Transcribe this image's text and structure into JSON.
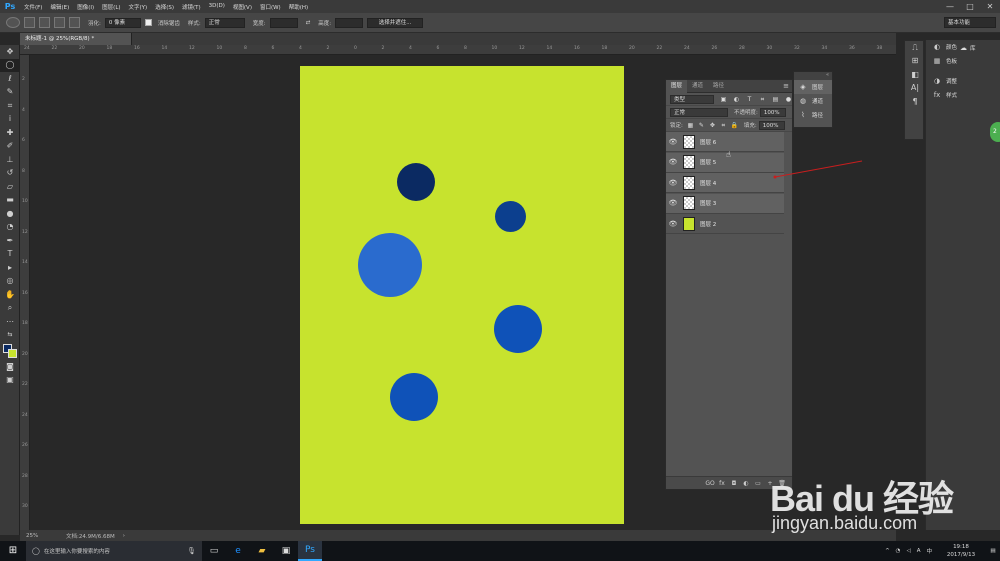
{
  "app": {
    "logo": "Ps"
  },
  "menu": [
    "文件(F)",
    "编辑(E)",
    "图像(I)",
    "图层(L)",
    "文字(Y)",
    "选择(S)",
    "滤镜(T)",
    "3D(D)",
    "视图(V)",
    "窗口(W)",
    "帮助(H)"
  ],
  "window_controls": [
    "—",
    "□",
    "✕"
  ],
  "options": {
    "feather_label": "羽化:",
    "feather_value": "0 像素",
    "antialias_label": "消除锯齿",
    "style_label": "样式:",
    "style_value": "正常",
    "width_label": "宽度:",
    "height_label": "高度:",
    "select_mask": "选择并遮住...",
    "workspace": "基本功能"
  },
  "document": {
    "tab_title": "未标题-1 @ 25%(RGB/8) *",
    "background_color": "#c7e32e",
    "circles": [
      {
        "color": "#0b2a62",
        "d": 38
      },
      {
        "color": "#0c3f8e",
        "d": 31
      },
      {
        "color": "#2a6bce",
        "d": 64
      },
      {
        "color": "#0f52b8",
        "d": 48
      },
      {
        "color": "#0f52b8",
        "d": 48
      }
    ]
  },
  "ruler_top": [
    "24",
    "22",
    "20",
    "18",
    "16",
    "14",
    "12",
    "10",
    "8",
    "6",
    "4",
    "2",
    "0",
    "2",
    "4",
    "6",
    "8",
    "10",
    "12",
    "14",
    "16",
    "18",
    "20",
    "22",
    "24",
    "26",
    "28",
    "30",
    "32",
    "34",
    "36",
    "38"
  ],
  "ruler_left": [
    "2",
    "4",
    "6",
    "8",
    "10",
    "12",
    "14",
    "16",
    "18",
    "20",
    "22",
    "24",
    "26",
    "28",
    "30"
  ],
  "status": {
    "zoom": "25%",
    "doc": "文档:24.9M/6.68M"
  },
  "layers_panel": {
    "tabs": [
      "图层",
      "通道",
      "路径"
    ],
    "filter_value": "类型",
    "blend_value": "正常",
    "opacity_label": "不透明度:",
    "opacity_value": "100%",
    "lock_label": "锁定:",
    "fill_label": "填充:",
    "fill_value": "100%",
    "layers": [
      {
        "name": "图层 6",
        "thumb": "transparent"
      },
      {
        "name": "图层 5",
        "thumb": "transparent"
      },
      {
        "name": "图层 4",
        "thumb": "transparent"
      },
      {
        "name": "图层 3",
        "thumb": "transparent"
      },
      {
        "name": "图层 2",
        "thumb": "#c7e32e"
      }
    ],
    "bottom_icons": [
      "GO",
      "fx",
      "◘",
      "◐",
      "▭",
      "+",
      "🗑"
    ]
  },
  "mini_panel": {
    "items": [
      {
        "icon": "◈",
        "label": "图层"
      },
      {
        "icon": "◍",
        "label": "通道"
      },
      {
        "icon": "⌇",
        "label": "路径"
      }
    ]
  },
  "dock": {
    "items": [
      {
        "icon": "◐",
        "label": "颜色"
      },
      {
        "icon": "▦",
        "label": "色板"
      },
      {
        "icon": "◑",
        "label": "调整"
      },
      {
        "icon": "fx",
        "label": "样式"
      }
    ],
    "library": "库"
  },
  "taskbar": {
    "search_placeholder": "在这里输入你要搜索的内容",
    "time": "19:18",
    "date": "2017/9/13",
    "ime": "A",
    "lang": "中"
  },
  "watermark": {
    "logo": "Bai du 经验",
    "url": "jingyan.baidu.com"
  },
  "badge": "2"
}
